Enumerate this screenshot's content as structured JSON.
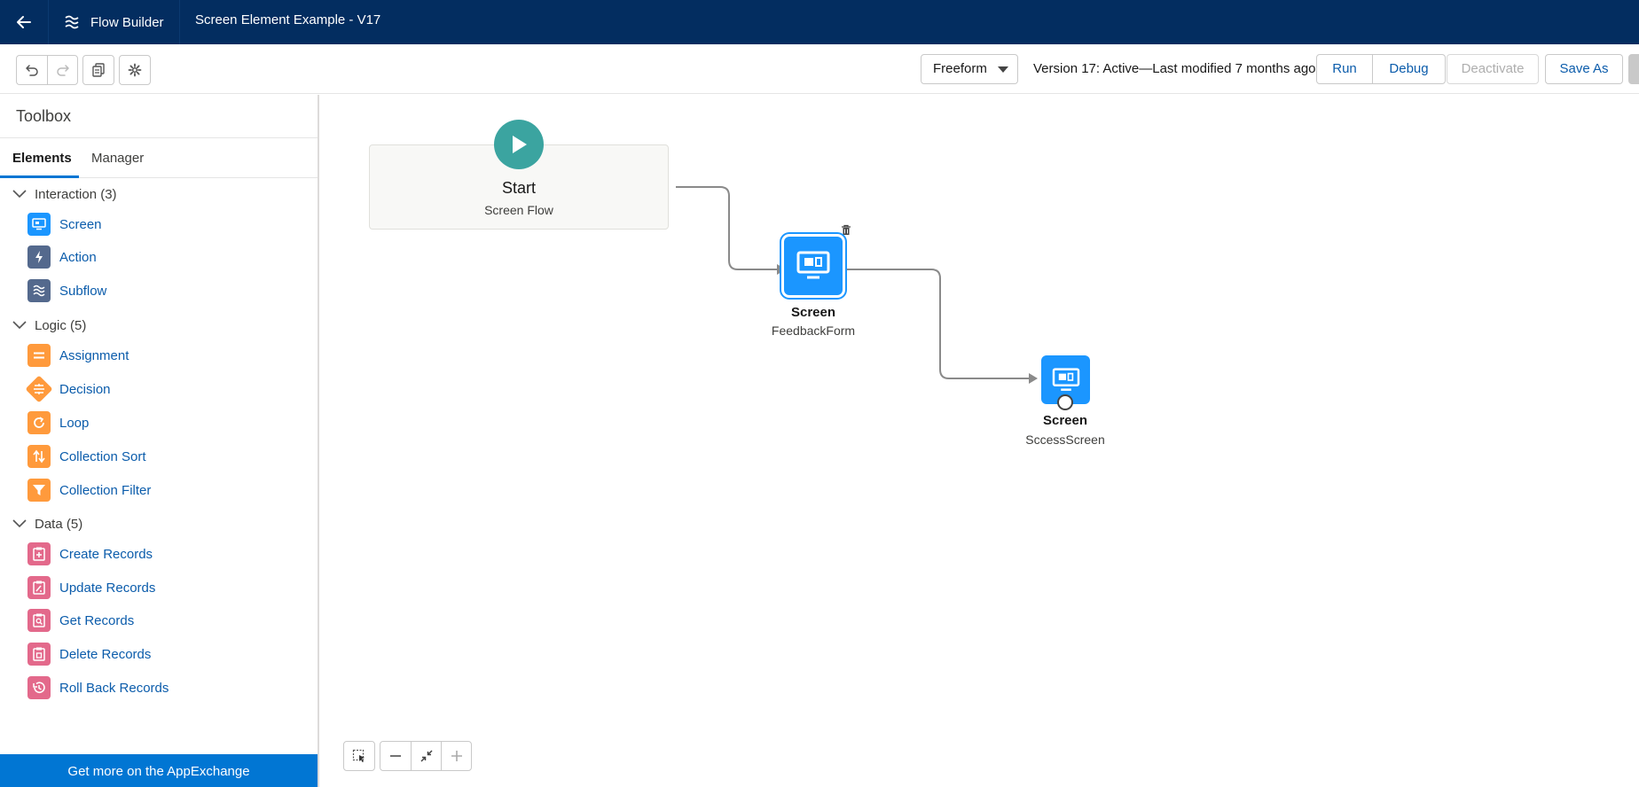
{
  "topbar": {
    "app_name": "Flow Builder",
    "flow_title": "Screen Element Example - V17"
  },
  "toolbar": {
    "layout_select": "Freeform",
    "version_status": "Version 17: Active—Last modified 7 months ago",
    "run_label": "Run",
    "debug_label": "Debug",
    "deactivate_label": "Deactivate",
    "save_as_label": "Save As"
  },
  "sidebar": {
    "title": "Toolbox",
    "tabs": {
      "elements": "Elements",
      "manager": "Manager"
    },
    "sections": {
      "interaction": "Interaction (3)",
      "logic": "Logic (5)",
      "data": "Data (5)"
    },
    "items": {
      "screen": "Screen",
      "action": "Action",
      "subflow": "Subflow",
      "assignment": "Assignment",
      "decision": "Decision",
      "loop": "Loop",
      "collection_sort": "Collection Sort",
      "collection_filter": "Collection Filter",
      "create_records": "Create Records",
      "update_records": "Update Records",
      "get_records": "Get Records",
      "delete_records": "Delete Records",
      "roll_back_records": "Roll Back Records"
    },
    "appexchange": "Get more on the AppExchange"
  },
  "canvas": {
    "start": {
      "label": "Start",
      "sub": "Screen Flow"
    },
    "node1": {
      "type": "Screen",
      "name": "FeedbackForm"
    },
    "node2": {
      "type": "Screen",
      "name": "SccessScreen"
    }
  },
  "colors": {
    "nav": "#032d60",
    "brand_blue": "#0176d3",
    "screen_blue": "#1b96ff",
    "start_teal": "#3ba4a0",
    "logic_orange": "#ff9a3c",
    "data_pink": "#e3698b",
    "interaction_slate": "#54698d"
  }
}
